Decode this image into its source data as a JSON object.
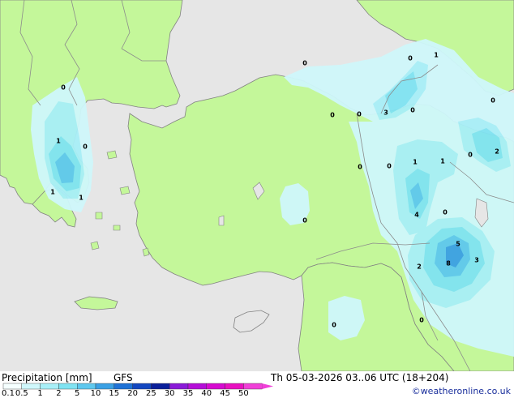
{
  "title_left": "Precipitation [mm]",
  "model": "GFS",
  "datetime": "Th 05-03-2026 03..06 UTC (18+204)",
  "credit": "©weatheronline.co.uk",
  "colorbar": {
    "labels": [
      "0.1",
      "0.5",
      "1",
      "2",
      "5",
      "10",
      "15",
      "20",
      "25",
      "30",
      "35",
      "40",
      "45",
      "50"
    ],
    "colors": [
      "#f5ffff",
      "#cff7fb",
      "#a8eff7",
      "#80e3f2",
      "#5ec8ee",
      "#3aa0e4",
      "#1f72d6",
      "#1347c0",
      "#0a1f9a",
      "#8a1ad8",
      "#b40ed8",
      "#d60ad0",
      "#e810c0",
      "#f040d8"
    ]
  },
  "colors": {
    "sea": "#e6e6e6",
    "land": "#c4f79a",
    "border": "#8c8c8c",
    "coast": "#828282"
  },
  "map_labels": [
    "0",
    "0",
    "1",
    "0",
    "0",
    "3",
    "0",
    "0",
    "1",
    "0",
    "0",
    "0",
    "1",
    "1",
    "0",
    "2",
    "1",
    "1",
    "0",
    "4",
    "0",
    "2",
    "5",
    "8",
    "3",
    "0",
    "0",
    "0"
  ]
}
